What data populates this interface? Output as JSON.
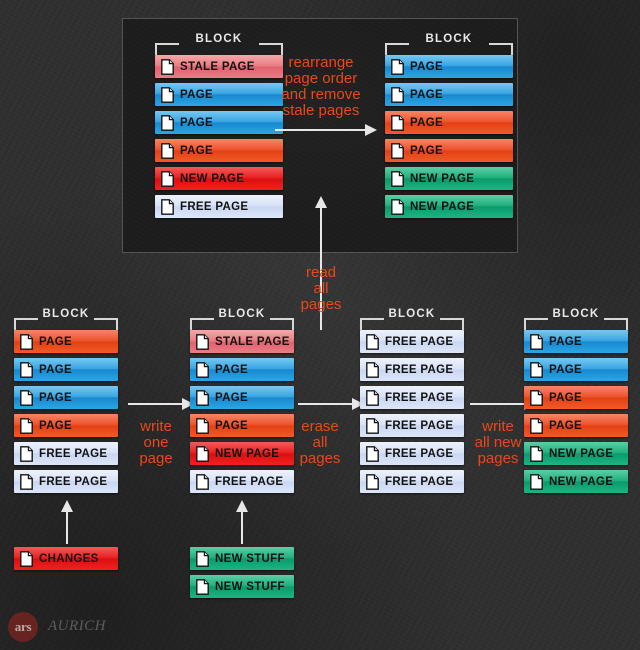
{
  "diagram": {
    "title": "SSD block rewrite / garbage collection illustration",
    "colors": {
      "background": "#2f2f2f",
      "panel": "#1c1c1c",
      "callout_text": "#e8491a",
      "arrow": "#e7e7e7",
      "block_label": "#e9e9e9",
      "page_blue": "#2f9fe0",
      "page_red": "#ee4a22",
      "page_new_red": "#e71717",
      "page_free": "#d6e0f6",
      "page_stale": "#e9777f",
      "page_green": "#15ab78",
      "bar_text": "#121212"
    },
    "block_label": "BLOCK",
    "page_icon": "document-page-icon"
  },
  "top_panel": {
    "left_block": {
      "title": "BLOCK",
      "pages": [
        {
          "label": "STALE PAGE",
          "variant": "stale"
        },
        {
          "label": "PAGE",
          "variant": "blue"
        },
        {
          "label": "PAGE",
          "variant": "blue"
        },
        {
          "label": "PAGE",
          "variant": "red"
        },
        {
          "label": "NEW PAGE",
          "variant": "newred"
        },
        {
          "label": "FREE PAGE",
          "variant": "free"
        }
      ]
    },
    "callout": "rearrange\npage order\nand remove\nstale pages",
    "callout_lines": [
      "rearrange",
      "page order",
      "and remove",
      "stale pages"
    ],
    "right_block": {
      "title": "BLOCK",
      "pages": [
        {
          "label": "PAGE",
          "variant": "blue"
        },
        {
          "label": "PAGE",
          "variant": "blue"
        },
        {
          "label": "PAGE",
          "variant": "red"
        },
        {
          "label": "PAGE",
          "variant": "red"
        },
        {
          "label": "NEW PAGE",
          "variant": "green"
        },
        {
          "label": "NEW PAGE",
          "variant": "green"
        }
      ]
    }
  },
  "read_callout_lines": [
    "read",
    "all",
    "pages"
  ],
  "bottom_row": {
    "block1": {
      "title": "BLOCK",
      "pages": [
        {
          "label": "PAGE",
          "variant": "red"
        },
        {
          "label": "PAGE",
          "variant": "blue"
        },
        {
          "label": "PAGE",
          "variant": "blue"
        },
        {
          "label": "PAGE",
          "variant": "red"
        },
        {
          "label": "FREE PAGE",
          "variant": "free"
        },
        {
          "label": "FREE PAGE",
          "variant": "free"
        }
      ],
      "input": [
        {
          "label": "CHANGES",
          "variant": "newred"
        }
      ]
    },
    "callout1_lines": [
      "write",
      "one",
      "page"
    ],
    "block2": {
      "title": "BLOCK",
      "pages": [
        {
          "label": "STALE PAGE",
          "variant": "stale"
        },
        {
          "label": "PAGE",
          "variant": "blue"
        },
        {
          "label": "PAGE",
          "variant": "blue"
        },
        {
          "label": "PAGE",
          "variant": "red"
        },
        {
          "label": "NEW PAGE",
          "variant": "newred"
        },
        {
          "label": "FREE PAGE",
          "variant": "free"
        }
      ],
      "input": [
        {
          "label": "NEW STUFF",
          "variant": "green"
        },
        {
          "label": "NEW STUFF",
          "variant": "green"
        }
      ]
    },
    "callout2_lines": [
      "erase",
      "all",
      "pages"
    ],
    "block3": {
      "title": "BLOCK",
      "pages": [
        {
          "label": "FREE PAGE",
          "variant": "free"
        },
        {
          "label": "FREE PAGE",
          "variant": "free"
        },
        {
          "label": "FREE PAGE",
          "variant": "free"
        },
        {
          "label": "FREE PAGE",
          "variant": "free"
        },
        {
          "label": "FREE PAGE",
          "variant": "free"
        },
        {
          "label": "FREE PAGE",
          "variant": "free"
        }
      ]
    },
    "callout3_lines": [
      "write",
      "all new",
      "pages"
    ],
    "block4": {
      "title": "BLOCK",
      "pages": [
        {
          "label": "PAGE",
          "variant": "blue"
        },
        {
          "label": "PAGE",
          "variant": "blue"
        },
        {
          "label": "PAGE",
          "variant": "red"
        },
        {
          "label": "PAGE",
          "variant": "red"
        },
        {
          "label": "NEW PAGE",
          "variant": "green"
        },
        {
          "label": "NEW PAGE",
          "variant": "green"
        }
      ]
    }
  },
  "logo": {
    "badge_text": "ars",
    "artist": "AURICH"
  }
}
